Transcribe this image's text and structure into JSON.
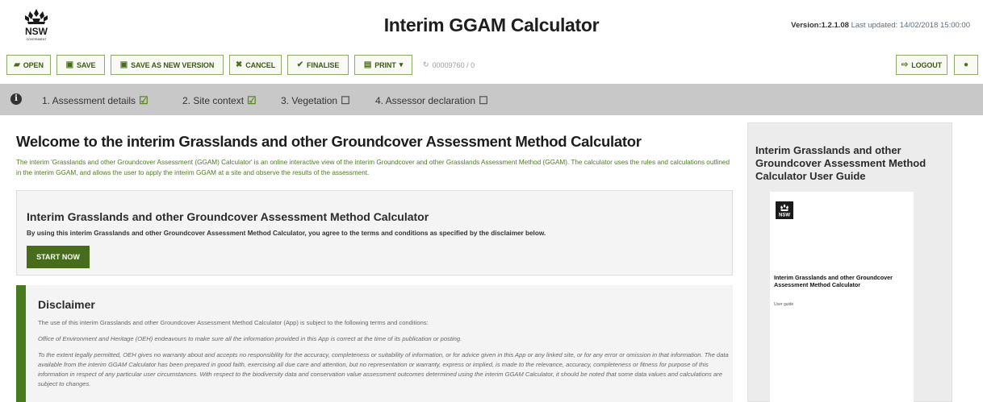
{
  "header": {
    "logo_text": "NSW",
    "logo_sub": "GOVERNMENT",
    "title": "Interim GGAM Calculator",
    "version_label": "Version:1.2.1.08",
    "last_updated": "Last updated: 14/02/2018 15:00:00"
  },
  "toolbar": {
    "open": "OPEN",
    "save": "SAVE",
    "save_new": "SAVE AS NEW VERSION",
    "cancel": "CANCEL",
    "finalise": "FINALISE",
    "print": "PRINT",
    "assessment_id": "00009760 / 0",
    "logout": "LOGOUT"
  },
  "steps": [
    {
      "label": "1. Assessment details",
      "status": "done"
    },
    {
      "label": "2. Site context",
      "status": "done"
    },
    {
      "label": "3. Vegetation",
      "status": "todo"
    },
    {
      "label": "4. Assessor declaration",
      "status": "todo"
    }
  ],
  "welcome": {
    "title": "Welcome to the interim Grasslands and other Groundcover Assessment Method Calculator",
    "text": "The interim 'Grasslands and other Groundcover Assessment (GGAM) Calculator' is an online interactive view of the interim Groundcover and other Grasslands Assessment Method (GGAM). The calculator uses the rules and calculations outlined in the interim GGAM, and allows the user to apply the interim GGAM at a site and observe the results of the assessment."
  },
  "start": {
    "title": "Interim Grasslands and other Groundcover Assessment Method Calculator",
    "text": "By using this interim Grasslands and other Groundcover Assessment Method Calculator, you agree to the terms and conditions as specified by the disclaimer below.",
    "button": "START NOW"
  },
  "disclaimer": {
    "title": "Disclaimer",
    "p1": "The use of this interim Grasslands and other Groundcover Assessment Method Calculator (App) is subject to the following terms and conditions:",
    "p2": "Office of Environment and Heritage (OEH) endeavours to make sure all the information provided in this App is correct at the time of its publication or posting.",
    "p3": "To the extent legally permitted, OEH gives no warranty about and accepts no responsibility for the accuracy, completeness or suitability of information, or for advice given in this App or any linked site, or for any error or omission in that information. The data available from the interim GGAM Calculator has been prepared in good faith, exercising all due care and attention, but no representation or warranty, express or implied, is made to the relevance, accuracy, completeness or fitness for purpose of this information in respect of any particular user circumstances. With respect to the biodiversity data and conservation value assessment outcomes determined using the interim GGAM Calculator, it should be noted that some data values and calculations are subject to changes."
  },
  "guide": {
    "title": "Interim Grasslands and other Groundcover Assessment Method Calculator User Guide",
    "doc_title": "Interim Grasslands and other Groundcover Assessment Method Calculator",
    "doc_sub": "User guide"
  },
  "colors": {
    "accent": "#466c1c",
    "steps_bar": "#c8c8c8",
    "welcome_text": "#4f7a22"
  }
}
